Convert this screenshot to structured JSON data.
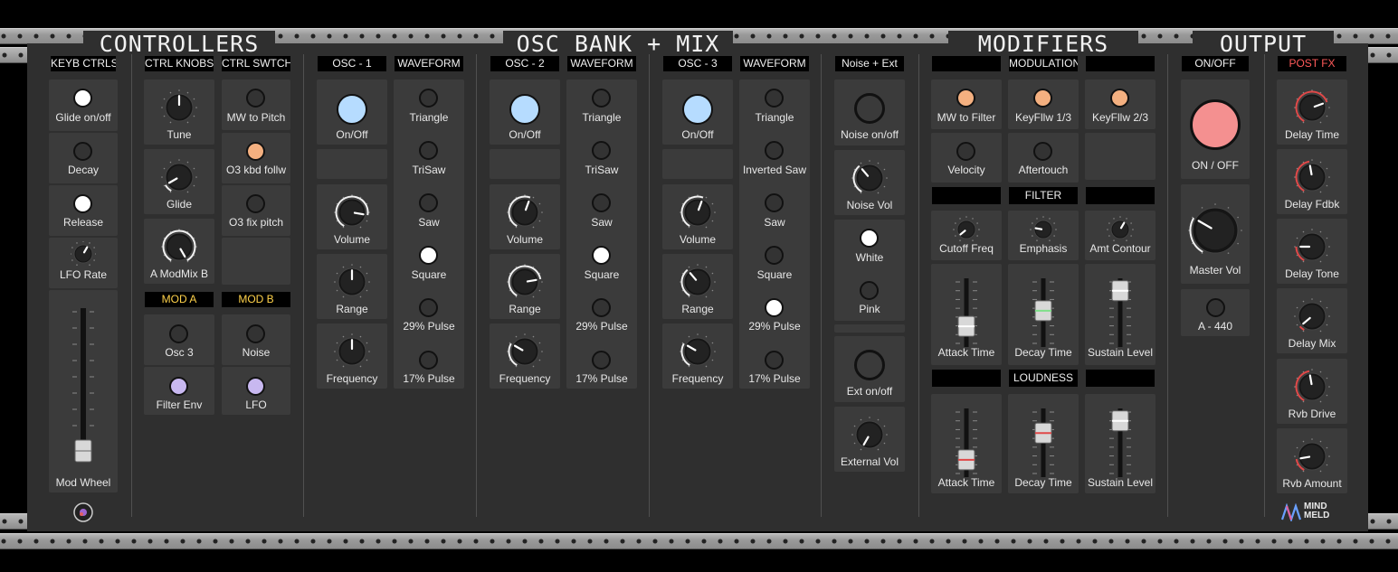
{
  "sections": {
    "controllers": "CONTROLLERS",
    "osc_bank": "OSC BANK + MIX",
    "modifiers": "MODIFIERS",
    "output": "OUTPUT"
  },
  "controllers": {
    "keyb_ctrls": "KEYB CTRLS",
    "ctrl_knobs": "CTRL KNOBS",
    "ctrl_swtch": "CTRL SWTCH",
    "glide_onoff": "Glide on/off",
    "decay": "Decay",
    "release": "Release",
    "lfo_rate": "LFO Rate",
    "mod_wheel": "Mod Wheel",
    "tune": "Tune",
    "glide": "Glide",
    "a_modmix_b": "A ModMix B",
    "mw_to_pitch": "MW to Pitch",
    "o3_kbd_follw": "O3 kbd follw",
    "o3_fix_pitch": "O3 fix pitch",
    "mod_a": "MOD A",
    "mod_b": "MOD B",
    "osc3": "Osc 3",
    "filter_env": "Filter Env",
    "noise": "Noise",
    "lfo": "LFO"
  },
  "osc": [
    {
      "header": "OSC - 1",
      "onoff": "On/Off",
      "volume": "Volume",
      "range": "Range",
      "frequency": "Frequency"
    },
    {
      "header": "OSC - 2",
      "onoff": "On/Off",
      "volume": "Volume",
      "range": "Range",
      "frequency": "Frequency"
    },
    {
      "header": "OSC - 3",
      "onoff": "On/Off",
      "volume": "Volume",
      "range": "Range",
      "frequency": "Frequency"
    }
  ],
  "waveform": [
    {
      "header": "WAVEFORM",
      "items": [
        "Triangle",
        "TriSaw",
        "Saw",
        "Square",
        "29% Pulse",
        "17% Pulse"
      ],
      "selected": 3
    },
    {
      "header": "WAVEFORM",
      "items": [
        "Triangle",
        "TriSaw",
        "Saw",
        "Square",
        "29% Pulse",
        "17% Pulse"
      ],
      "selected": 3
    },
    {
      "header": "WAVEFORM",
      "items": [
        "Triangle",
        "Inverted Saw",
        "Saw",
        "Square",
        "29% Pulse",
        "17% Pulse"
      ],
      "selected": 4
    }
  ],
  "noise_ext": {
    "header": "Noise + Ext",
    "noise_onoff": "Noise on/off",
    "noise_vol": "Noise Vol",
    "white": "White",
    "pink": "Pink",
    "ext_onoff": "Ext on/off",
    "external_vol": "External Vol"
  },
  "modifiers": {
    "modulation": "MODULATION",
    "mw_to_filter": "MW to Filter",
    "keyfllw_13": "KeyFllw 1/3",
    "keyfllw_23": "KeyFllw 2/3",
    "velocity": "Velocity",
    "aftertouch": "Aftertouch",
    "filter": "FILTER",
    "cutoff_freq": "Cutoff Freq",
    "emphasis": "Emphasis",
    "amt_contour": "Amt Contour",
    "attack_time": "Attack Time",
    "decay_time": "Decay Time",
    "sustain_level": "Sustain Level",
    "loudness": "LOUDNESS"
  },
  "output": {
    "onoff_header": "ON/OFF",
    "onoff": "ON / OFF",
    "master_vol": "Master Vol",
    "a440": "A - 440"
  },
  "post_fx": {
    "header": "POST FX",
    "items": [
      "Delay Time",
      "Delay Fdbk",
      "Delay Tone",
      "Delay Mix",
      "Rvb Drive",
      "Rvb Amount"
    ]
  },
  "brand": {
    "line1": "MIND",
    "line2": "MELD"
  },
  "colors": {
    "panel": "#2f2f2f",
    "cell": "#3b3b3b",
    "accent_red": "#e04848",
    "accent_yellow": "#ffd24a",
    "button_blue": "#b6dcff",
    "button_orange": "#f4b080",
    "button_lilac": "#c8b8f0"
  }
}
